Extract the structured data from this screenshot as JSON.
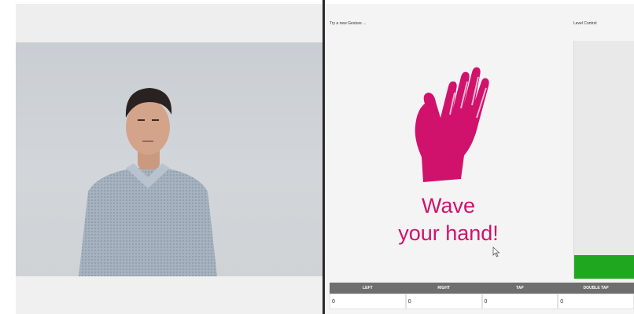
{
  "gesture_panel": {
    "hint": "Try a new Gesture ...",
    "prompt_line1": "Wave",
    "prompt_line2": "your hand!",
    "icon": "waving-hand-icon",
    "accent_color": "#d0126d"
  },
  "level_control": {
    "title": "Level Control",
    "level_fraction": 0.1,
    "fill_color": "#1fa81f"
  },
  "gesture_table": {
    "headers": [
      "LEFT",
      "RIGHT",
      "TAP",
      "DOUBLE TAP"
    ],
    "values": [
      "0",
      "0",
      "0",
      "0"
    ]
  }
}
